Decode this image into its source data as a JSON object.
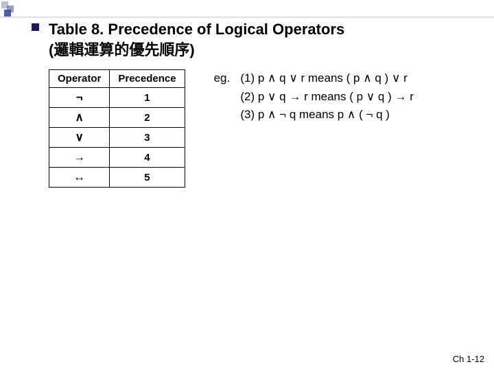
{
  "title_main": "Table 8. Precedence of Logical Operators",
  "title_sub": "(邏輯運算的優先順序)",
  "table": {
    "header_op": "Operator",
    "header_prec": "Precedence",
    "rows": [
      {
        "op": "¬",
        "prec": "1"
      },
      {
        "op": "∧",
        "prec": "2"
      },
      {
        "op": "∨",
        "prec": "3"
      },
      {
        "op": "→",
        "prec": "4"
      },
      {
        "op": "↔",
        "prec": "5"
      }
    ]
  },
  "eg_label": "eg.",
  "examples": [
    "(1) p ∧ q ∨ r  means ( p ∧ q ) ∨ r",
    "(2) p ∨ q → r  means ( p ∨ q ) → r",
    "(3) p ∧ ¬ q  means  p ∧ ( ¬ q )"
  ],
  "footer": "Ch 1-12"
}
